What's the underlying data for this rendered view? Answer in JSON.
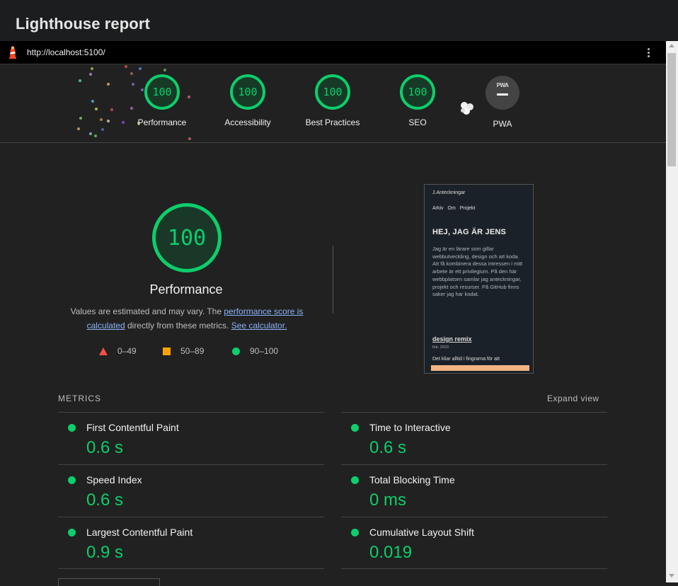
{
  "app": {
    "title": "Lighthouse report"
  },
  "urlbar": {
    "url": "http://localhost:5100/"
  },
  "categories": [
    {
      "score": "100",
      "label": "Performance"
    },
    {
      "score": "100",
      "label": "Accessibility"
    },
    {
      "score": "100",
      "label": "Best Practices"
    },
    {
      "score": "100",
      "label": "SEO"
    }
  ],
  "pwa": {
    "badge": "PWA",
    "label": "PWA"
  },
  "performance": {
    "score": "100",
    "title": "Performance",
    "desc_before": "Values are estimated and may vary. The ",
    "desc_link1": "performance score is calculated",
    "desc_middle": " directly from these metrics. ",
    "desc_link2": "See calculator.",
    "legend": [
      {
        "range": "0–49"
      },
      {
        "range": "50–89"
      },
      {
        "range": "90–100"
      }
    ]
  },
  "screenshot": {
    "site": "J.Anteckningar",
    "nav": "Arkiv Om Projekt",
    "heading": "HEJ, JAG ÄR JENS",
    "paragraph": "Jag är en lärare som gillar webbutveckling, design och att koda. Att få kombinera dessa intressen i mitt arbete är ett privilegium. På den här webbplatsen samlar jag anteckningar, projekt och resurser. På GitHub finns saker jag har kodat.",
    "post_title": "design remix",
    "post_date": "feb. 2023",
    "post_line": "Det kliar alltid i fingrarna för att"
  },
  "metrics": {
    "header": "METRICS",
    "expand": "Expand view",
    "items": [
      {
        "label": "First Contentful Paint",
        "value": "0.6 s"
      },
      {
        "label": "Time to Interactive",
        "value": "0.6 s"
      },
      {
        "label": "Speed Index",
        "value": "0.6 s"
      },
      {
        "label": "Total Blocking Time",
        "value": "0 ms"
      },
      {
        "label": "Largest Contentful Paint",
        "value": "0.9 s"
      },
      {
        "label": "Cumulative Layout Shift",
        "value": "0.019"
      }
    ]
  },
  "colors": {
    "pass": "#0cce6b",
    "average": "#ffa400",
    "fail": "#ff4e42",
    "link": "#8ab4f8",
    "background": "#212121"
  },
  "icons": {
    "lighthouse": "lighthouse-logo-icon",
    "menu": "kebab-menu-icon",
    "fireworks": "fireworks-icon"
  }
}
